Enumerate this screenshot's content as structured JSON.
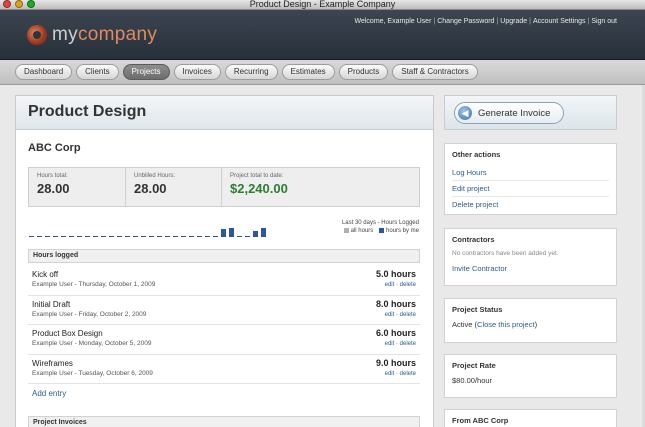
{
  "window": {
    "title": "Product Design - Example Company"
  },
  "header": {
    "logo_a": "my",
    "logo_b": "company",
    "welcome": "Welcome, Example User",
    "links": [
      "Change Password",
      "Upgrade",
      "Account Settings",
      "Sign out"
    ]
  },
  "nav": {
    "tabs": [
      "Dashboard",
      "Clients",
      "Projects",
      "Invoices",
      "Recurring",
      "Estimates",
      "Products",
      "Staff & Contractors"
    ],
    "active": "Projects"
  },
  "project": {
    "title": "Product Design",
    "client": "ABC Corp",
    "stats": {
      "hours_total_label": "Hours total:",
      "hours_total": "28.00",
      "unbilled_label": "Unbilled Hours:",
      "unbilled": "28.00",
      "project_total_label": "Project total to date:",
      "project_total": "$2,240.00"
    },
    "chart_legend": {
      "title": "Last 30 days - Hours Logged",
      "all": "all hours",
      "mine": "hours by me"
    },
    "hours_section": "Hours logged",
    "entries": [
      {
        "name": "Kick off",
        "meta": "Example User - Thursday, October 1, 2009",
        "hours": "5.0 hours",
        "edit": "edit",
        "delete": "delete"
      },
      {
        "name": "Initial Draft",
        "meta": "Example User - Friday, October 2, 2009",
        "hours": "8.0 hours",
        "edit": "edit",
        "delete": "delete"
      },
      {
        "name": "Product Box Design",
        "meta": "Example User - Monday, October 5, 2009",
        "hours": "6.0 hours",
        "edit": "edit",
        "delete": "delete"
      },
      {
        "name": "Wireframes",
        "meta": "Example User - Tuesday, October 6, 2009",
        "hours": "9.0 hours",
        "edit": "edit",
        "delete": "delete"
      }
    ],
    "add_entry": "Add entry",
    "invoices_section": "Project Invoices"
  },
  "sidebar": {
    "generate_invoice": "Generate Invoice",
    "other_actions": {
      "title": "Other actions",
      "items": [
        "Log Hours",
        "Edit project",
        "Delete project"
      ]
    },
    "contractors": {
      "title": "Contractors",
      "note": "No contractors have been added yet.",
      "link": "Invite Contractor"
    },
    "status": {
      "title": "Project Status",
      "value": "Active",
      "link": "Close this project"
    },
    "rate": {
      "title": "Project Rate",
      "value": "$80.00/hour"
    },
    "from": {
      "title": "From ABC Corp"
    }
  },
  "colors": {
    "accent_link": "#2a5d91",
    "money": "#2e7d32",
    "bar_mine": "#2e55a5",
    "bar_all": "#b0b0b0"
  }
}
